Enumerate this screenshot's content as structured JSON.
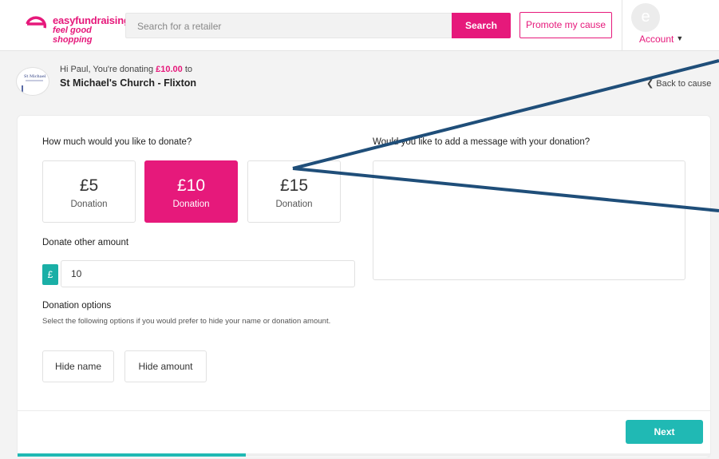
{
  "header": {
    "logo_line1": "easyfundraising",
    "logo_line2": "feel good shopping",
    "search_placeholder": "Search for a retailer",
    "search_button": "Search",
    "promote_button": "Promote my cause",
    "avatar_letter": "e",
    "account_label": "Account",
    "account_caret": "▼"
  },
  "cause": {
    "logo_text": "St Michael",
    "greeting_prefix": "Hi Paul, You're donating ",
    "amount": "£10.00",
    "greeting_suffix": " to",
    "name": "St Michael's Church - Flixton",
    "back_link": "❮ Back to cause"
  },
  "form": {
    "amount_question": "How much would you like to donate?",
    "message_question": "Would you like to add a message with your donation?",
    "amount_options": [
      {
        "value": "£5",
        "label": "Donation"
      },
      {
        "value": "£10",
        "label": "Donation"
      },
      {
        "value": "£15",
        "label": "Donation"
      }
    ],
    "selected_amount_index": 1,
    "other_amount_label": "Donate other amount",
    "currency_symbol": "£",
    "other_amount_value": "10",
    "options_title": "Donation options",
    "options_help": "Select the following options if you would prefer to hide your name or donation amount.",
    "hide_name": "Hide name",
    "hide_amount": "Hide amount",
    "next_button": "Next",
    "progress_fraction": 0.33
  },
  "colors": {
    "brand_pink": "#e6197b",
    "teal": "#20b9b4",
    "annotation_line": "#1f4e79"
  }
}
